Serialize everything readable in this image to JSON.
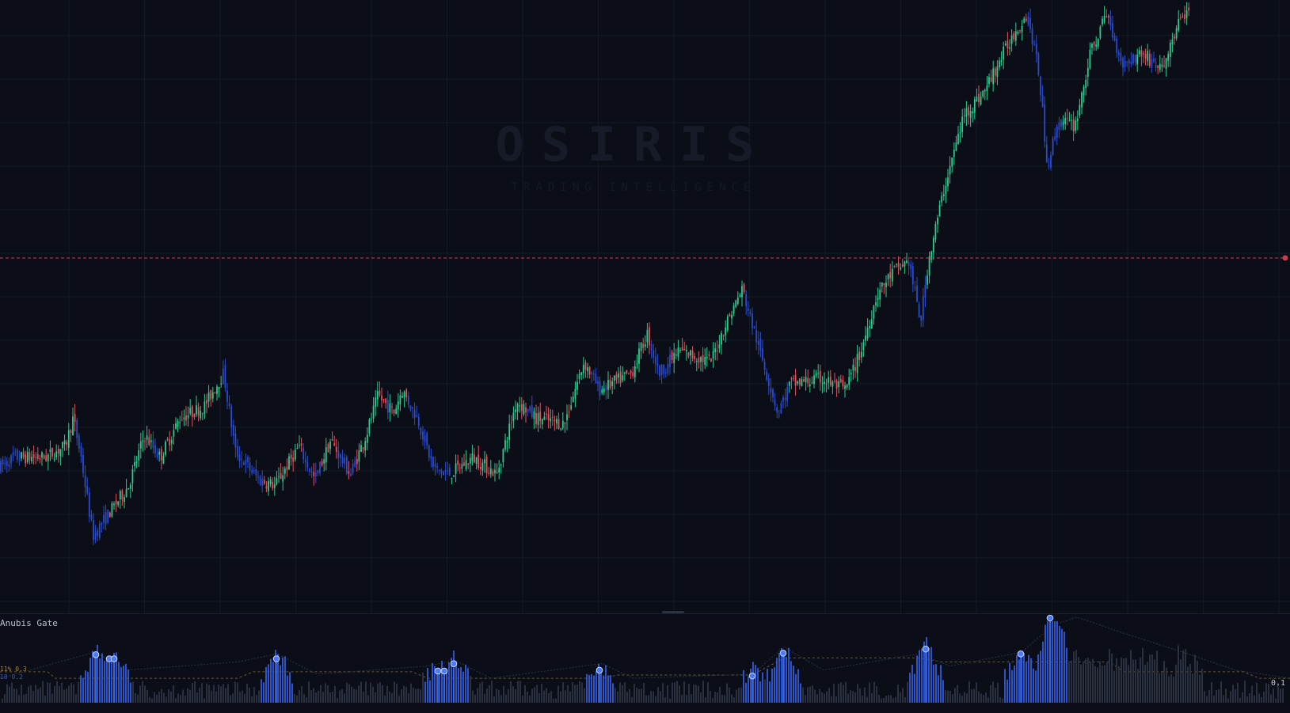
{
  "chart_data": [
    {
      "type": "candlestick",
      "title": "",
      "xlabel": "",
      "ylabel": "",
      "ylim": [
        0,
        100
      ],
      "grid": true,
      "horizontal_line": {
        "value": 55.5,
        "style": "dashed",
        "color": "#d03a4e"
      },
      "colors": {
        "up": "#2ecc8e",
        "down": "#e8505e",
        "weak": "#2a4ad0"
      },
      "anchors": [
        [
          0,
          18
        ],
        [
          20,
          20
        ],
        [
          60,
          20
        ],
        [
          85,
          22
        ],
        [
          95,
          27
        ],
        [
          105,
          20
        ],
        [
          120,
          6
        ],
        [
          140,
          10
        ],
        [
          165,
          15
        ],
        [
          185,
          24
        ],
        [
          205,
          20
        ],
        [
          230,
          27
        ],
        [
          260,
          29
        ],
        [
          285,
          35
        ],
        [
          300,
          21
        ],
        [
          330,
          16
        ],
        [
          350,
          15
        ],
        [
          380,
          22
        ],
        [
          400,
          16
        ],
        [
          420,
          23
        ],
        [
          445,
          17
        ],
        [
          465,
          24
        ],
        [
          480,
          31
        ],
        [
          500,
          28
        ],
        [
          510,
          32
        ],
        [
          530,
          27
        ],
        [
          550,
          18
        ],
        [
          570,
          17
        ],
        [
          600,
          20
        ],
        [
          630,
          17
        ],
        [
          655,
          30
        ],
        [
          680,
          27
        ],
        [
          715,
          26
        ],
        [
          740,
          37
        ],
        [
          760,
          32
        ],
        [
          800,
          35
        ],
        [
          820,
          42
        ],
        [
          835,
          35
        ],
        [
          860,
          39
        ],
        [
          900,
          37
        ],
        [
          920,
          44
        ],
        [
          940,
          50
        ],
        [
          960,
          40
        ],
        [
          985,
          28
        ],
        [
          1000,
          33
        ],
        [
          1040,
          34
        ],
        [
          1070,
          32
        ],
        [
          1090,
          39
        ],
        [
          1110,
          49
        ],
        [
          1130,
          53
        ],
        [
          1150,
          55
        ],
        [
          1165,
          44
        ],
        [
          1175,
          55
        ],
        [
          1195,
          68
        ],
        [
          1220,
          81
        ],
        [
          1245,
          85
        ],
        [
          1270,
          92
        ],
        [
          1285,
          96
        ],
        [
          1300,
          99
        ],
        [
          1315,
          88
        ],
        [
          1325,
          72
        ],
        [
          1340,
          80
        ],
        [
          1360,
          79
        ],
        [
          1380,
          92
        ],
        [
          1400,
          99
        ],
        [
          1420,
          90
        ],
        [
          1445,
          92
        ],
        [
          1470,
          89
        ],
        [
          1490,
          97
        ],
        [
          1500,
          99
        ]
      ]
    },
    {
      "type": "bar",
      "title": "Anubis Gate",
      "signals": [
        {
          "x": 121,
          "v": 0.55
        },
        {
          "x": 138,
          "v": 0.5
        },
        {
          "x": 144,
          "v": 0.5
        },
        {
          "x": 349,
          "v": 0.5
        },
        {
          "x": 553,
          "v": 0.35
        },
        {
          "x": 561,
          "v": 0.35
        },
        {
          "x": 573,
          "v": 0.44
        },
        {
          "x": 757,
          "v": 0.36
        },
        {
          "x": 950,
          "v": 0.29
        },
        {
          "x": 989,
          "v": 0.57
        },
        {
          "x": 1169,
          "v": 0.62
        },
        {
          "x": 1289,
          "v": 0.56
        },
        {
          "x": 1326,
          "v": 1.0
        }
      ]
    }
  ],
  "watermark": {
    "title": "OSIRIS",
    "subtitle": "TRADING INTELLIGENCE"
  },
  "pane": {
    "label": "Anubis Gate",
    "legend_a": "11% 0.3",
    "legend_b": "18 0.2",
    "scale_value": "0.1"
  }
}
